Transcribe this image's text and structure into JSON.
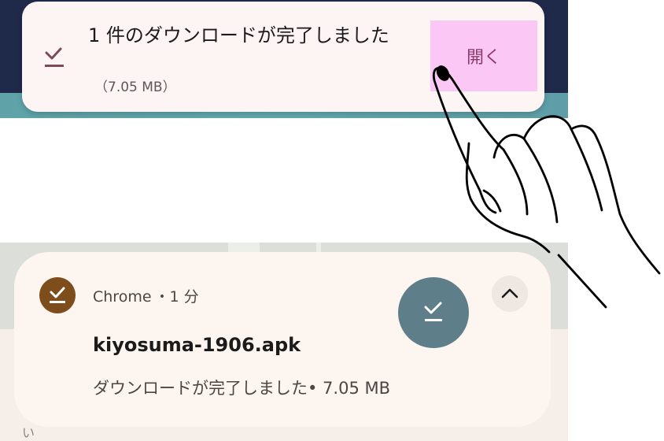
{
  "toast": {
    "icon": "download-done-icon",
    "title": "1 件のダウンロードが完了しました",
    "size": "（7.05 MB）",
    "open_label": "開く"
  },
  "notification": {
    "app_icon": "download-done-icon",
    "app_name": "Chrome",
    "time": "・1 分",
    "file_name": "kiyosuma-1906.apk",
    "description": "ダウンロードが完了しました• 7.05 MB",
    "action_icon": "download-done-icon",
    "expand_icon": "chevron-up-icon"
  },
  "background": {
    "fragment_text": "い"
  },
  "colors": {
    "toast_bg": "#fcf5f4",
    "open_button_bg": "#fbc8f6",
    "open_button_text": "#8a3a68",
    "app_icon_bg": "#7d4e1c",
    "action_circle_bg": "#5e7e8a",
    "notification_bg": "#fcf5f0",
    "header_bg": "#1f2a4a"
  }
}
